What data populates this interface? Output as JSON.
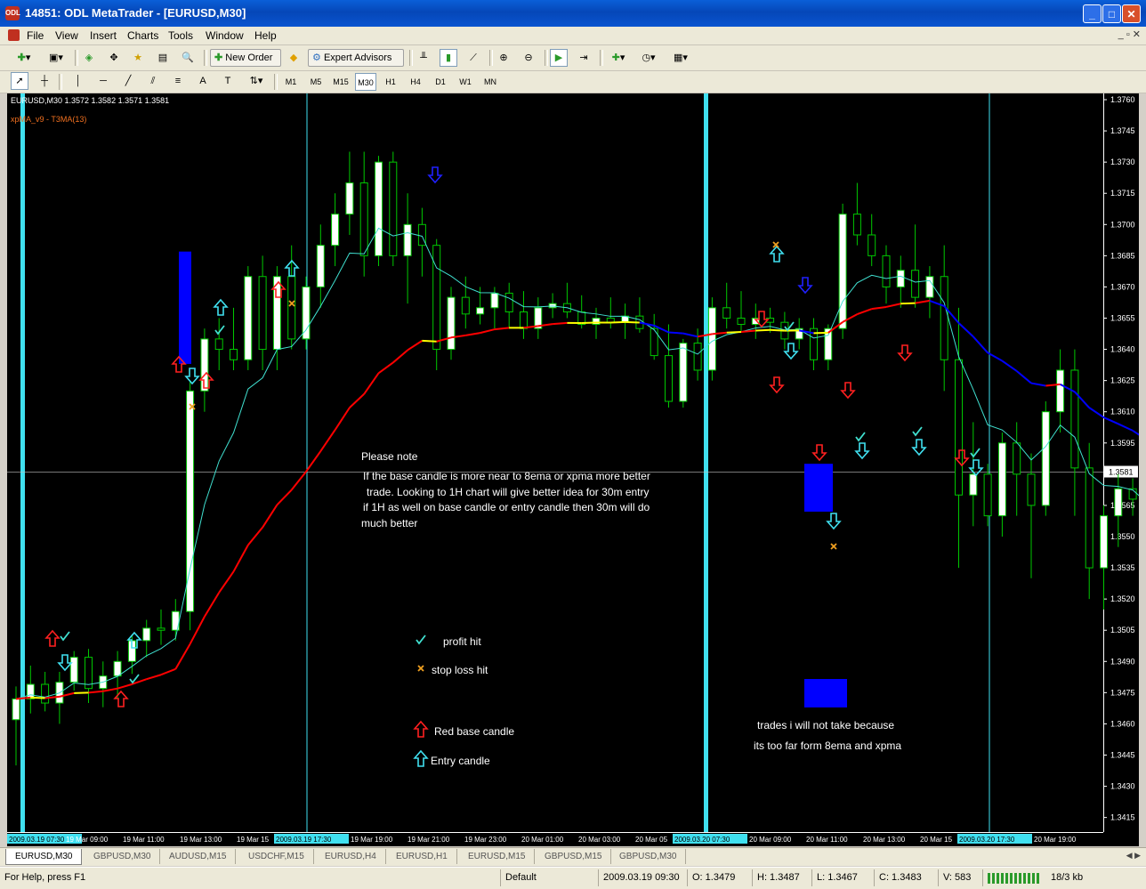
{
  "window": {
    "title": "14851: ODL MetaTrader - [EURUSD,M30]",
    "app_icon": "ODL",
    "minimize": "_",
    "maximize": "□",
    "close": "✕"
  },
  "menu": {
    "items": [
      "File",
      "View",
      "Insert",
      "Charts",
      "Tools",
      "Window",
      "Help"
    ],
    "mdi_controls": "_ ▫ ✕"
  },
  "toolbar": {
    "new_order_label": "New Order",
    "expert_advisors_label": "Expert Advisors"
  },
  "timeframes": [
    "M1",
    "M5",
    "M15",
    "M30",
    "H1",
    "H4",
    "D1",
    "W1",
    "MN"
  ],
  "active_timeframe": "M30",
  "chart": {
    "symbol_info": "EURUSD,M30  1.3572 1.3582 1.3571 1.3581",
    "indicator_label": "xpMA_v9 - T3MA(13)",
    "current_price": "1.3581",
    "price_ticks": [
      "1.3760",
      "1.3745",
      "1.3730",
      "1.3715",
      "1.3700",
      "1.3685",
      "1.3670",
      "1.3655",
      "1.3640",
      "1.3625",
      "1.3610",
      "1.3595",
      "1.3565",
      "1.3550",
      "1.3535",
      "1.3520",
      "1.3505",
      "1.3490",
      "1.3475",
      "1.3460",
      "1.3445",
      "1.3430",
      "1.3415"
    ],
    "time_ticks": [
      "2009.03.19 07:30",
      "19 Mar 09:00",
      "19 Mar 11:00",
      "19 Mar 13:00",
      "19 Mar 15",
      "2009.03.19 17:30",
      "19 Mar 19:00",
      "19 Mar 21:00",
      "19 Mar 23:00",
      "20 Mar 01:00",
      "20 Mar 03:00",
      "20 Mar 05",
      "2009.03.20 07:30",
      "20 Mar 09:00",
      "20 Mar 11:00",
      "20 Mar 13:00",
      "20 Mar 15",
      "2009.03.20 17:30",
      "20 Mar 19:00"
    ],
    "colors": {
      "background": "#000000",
      "bull_candle": "#ffffff",
      "bear_candle": "#000000",
      "wick": "#00c800",
      "ma_fast": "#40e0d0",
      "ma_up": "#ff0000",
      "ma_down": "#0000ff",
      "ma_flat": "#ffff00",
      "entry_arrow": "#40e0f0",
      "base_arrow": "#ff2020",
      "down_marker": "#2020ff",
      "stop_loss": "#f0a020",
      "highlight": "#0000ff"
    },
    "notes": {
      "please_note": "Please note",
      "body_lines": [
        "If the base candle is more near to 8ema or xpma more better",
        "trade. Looking to 1H chart will give better idea for 30m entry",
        "if 1H as well on base candle or entry candle then 30m will do",
        "much better"
      ],
      "legend_profit": "profit hit",
      "legend_stop": "stop loss hit",
      "legend_red": "Red base candle",
      "legend_entry": "Entry candle",
      "legend_notake_1": "trades i will not take because",
      "legend_notake_2": "its too far form 8ema and xpma"
    },
    "chart_data": {
      "type": "candlestick",
      "candles": [
        [
          1.3462,
          1.3478,
          1.344,
          1.3472
        ],
        [
          1.3472,
          1.3488,
          1.3465,
          1.3479
        ],
        [
          1.3479,
          1.3485,
          1.3466,
          1.347
        ],
        [
          1.347,
          1.3485,
          1.346,
          1.348
        ],
        [
          1.348,
          1.3495,
          1.3476,
          1.3492
        ],
        [
          1.3492,
          1.3496,
          1.347,
          1.3477
        ],
        [
          1.3477,
          1.349,
          1.3468,
          1.3483
        ],
        [
          1.3483,
          1.3495,
          1.3472,
          1.349
        ],
        [
          1.349,
          1.3503,
          1.3484,
          1.35
        ],
        [
          1.35,
          1.351,
          1.3492,
          1.3506
        ],
        [
          1.3506,
          1.3515,
          1.3498,
          1.3505
        ],
        [
          1.3505,
          1.352,
          1.35,
          1.3514
        ],
        [
          1.3514,
          1.3625,
          1.3505,
          1.362
        ],
        [
          1.362,
          1.365,
          1.361,
          1.3645
        ],
        [
          1.3645,
          1.3655,
          1.363,
          1.364
        ],
        [
          1.364,
          1.366,
          1.363,
          1.3635
        ],
        [
          1.3635,
          1.368,
          1.363,
          1.3675
        ],
        [
          1.3675,
          1.3685,
          1.363,
          1.364
        ],
        [
          1.364,
          1.368,
          1.363,
          1.3675
        ],
        [
          1.3675,
          1.369,
          1.364,
          1.3645
        ],
        [
          1.3645,
          1.3675,
          1.364,
          1.367
        ],
        [
          1.367,
          1.37,
          1.366,
          1.369
        ],
        [
          1.369,
          1.3715,
          1.368,
          1.3705
        ],
        [
          1.3705,
          1.3735,
          1.3695,
          1.372
        ],
        [
          1.372,
          1.3735,
          1.3675,
          1.3685
        ],
        [
          1.3685,
          1.3733,
          1.368,
          1.373
        ],
        [
          1.373,
          1.3735,
          1.368,
          1.3685
        ],
        [
          1.3685,
          1.3715,
          1.3662,
          1.37
        ],
        [
          1.37,
          1.3708,
          1.3675,
          1.369
        ],
        [
          1.369,
          1.3693,
          1.363,
          1.364
        ],
        [
          1.364,
          1.367,
          1.3635,
          1.3665
        ],
        [
          1.3665,
          1.3675,
          1.365,
          1.3657
        ],
        [
          1.3657,
          1.367,
          1.3652,
          1.366
        ],
        [
          1.366,
          1.367,
          1.365,
          1.3667
        ],
        [
          1.3667,
          1.3672,
          1.365,
          1.3658
        ],
        [
          1.3658,
          1.3668,
          1.3645,
          1.365
        ],
        [
          1.365,
          1.3665,
          1.3645,
          1.366
        ],
        [
          1.366,
          1.3667,
          1.3655,
          1.3662
        ],
        [
          1.3662,
          1.3672,
          1.3655,
          1.3658
        ],
        [
          1.3658,
          1.3666,
          1.365,
          1.3652
        ],
        [
          1.3652,
          1.366,
          1.3645,
          1.3655
        ],
        [
          1.3655,
          1.3665,
          1.365,
          1.3653
        ],
        [
          1.3653,
          1.3662,
          1.3645,
          1.3656
        ],
        [
          1.3656,
          1.3665,
          1.3648,
          1.365
        ],
        [
          1.365,
          1.3657,
          1.3635,
          1.3637
        ],
        [
          1.3637,
          1.3652,
          1.3612,
          1.3615
        ],
        [
          1.3615,
          1.3645,
          1.3612,
          1.3643
        ],
        [
          1.3643,
          1.365,
          1.3625,
          1.363
        ],
        [
          1.363,
          1.3665,
          1.3625,
          1.366
        ],
        [
          1.366,
          1.3672,
          1.365,
          1.3655
        ],
        [
          1.3655,
          1.3668,
          1.3648,
          1.3652
        ],
        [
          1.3652,
          1.3662,
          1.3645,
          1.3655
        ],
        [
          1.3655,
          1.366,
          1.3648,
          1.3653
        ],
        [
          1.3653,
          1.3658,
          1.364,
          1.3645
        ],
        [
          1.3645,
          1.3655,
          1.364,
          1.365
        ],
        [
          1.365,
          1.3655,
          1.363,
          1.3635
        ],
        [
          1.3635,
          1.3652,
          1.363,
          1.365
        ],
        [
          1.365,
          1.371,
          1.3645,
          1.3705
        ],
        [
          1.3705,
          1.372,
          1.369,
          1.3695
        ],
        [
          1.3695,
          1.3705,
          1.368,
          1.3685
        ],
        [
          1.3685,
          1.369,
          1.3662,
          1.367
        ],
        [
          1.367,
          1.3685,
          1.366,
          1.3678
        ],
        [
          1.3678,
          1.37,
          1.366,
          1.3665
        ],
        [
          1.3665,
          1.368,
          1.3655,
          1.3675
        ],
        [
          1.3675,
          1.369,
          1.362,
          1.3635
        ],
        [
          1.3635,
          1.366,
          1.3535,
          1.357
        ],
        [
          1.357,
          1.3605,
          1.3555,
          1.358
        ],
        [
          1.358,
          1.3585,
          1.3555,
          1.356
        ],
        [
          1.356,
          1.36,
          1.355,
          1.3595
        ],
        [
          1.3595,
          1.3605,
          1.356,
          1.358
        ],
        [
          1.358,
          1.359,
          1.353,
          1.3565
        ],
        [
          1.3565,
          1.3615,
          1.356,
          1.361
        ],
        [
          1.361,
          1.364,
          1.36,
          1.363
        ],
        [
          1.363,
          1.364,
          1.356,
          1.3583
        ],
        [
          1.3583,
          1.3595,
          1.352,
          1.3535
        ],
        [
          1.3535,
          1.3565,
          1.3515,
          1.356
        ],
        [
          1.356,
          1.358,
          1.3545,
          1.3573
        ],
        [
          1.3573,
          1.3578,
          1.356,
          1.3568
        ],
        [
          1.3568,
          1.358,
          1.354,
          1.355
        ],
        [
          1.355,
          1.3575,
          1.354,
          1.357
        ],
        [
          1.357,
          1.3575,
          1.3545,
          1.357
        ],
        [
          1.357,
          1.3578,
          1.3548,
          1.3555
        ],
        [
          1.3555,
          1.356,
          1.3545,
          1.355
        ],
        [
          1.355,
          1.356,
          1.3545,
          1.3553
        ],
        [
          1.3553,
          1.357,
          1.355,
          1.3565
        ],
        [
          1.3565,
          1.3575,
          1.356,
          1.357
        ],
        [
          1.3572,
          1.3582,
          1.3571,
          1.3581
        ]
      ],
      "ylim": [
        1.3408,
        1.3763
      ]
    }
  },
  "tabs": [
    "EURUSD,M30",
    "GBPUSD,M30",
    "AUDUSD,M15",
    "USDCHF,M15",
    "EURUSD,H4",
    "EURUSD,H1",
    "EURUSD,M15",
    "GBPUSD,M15",
    "GBPUSD,M30"
  ],
  "tab_nav": "◀ ▶",
  "status": {
    "help": "For Help, press F1",
    "profile": "Default",
    "datetime": "2009.03.19 09:30",
    "open": "O: 1.3479",
    "high": "H: 1.3487",
    "low": "L: 1.3467",
    "close": "C: 1.3483",
    "volume": "V: 583",
    "traffic": "18/3 kb"
  }
}
